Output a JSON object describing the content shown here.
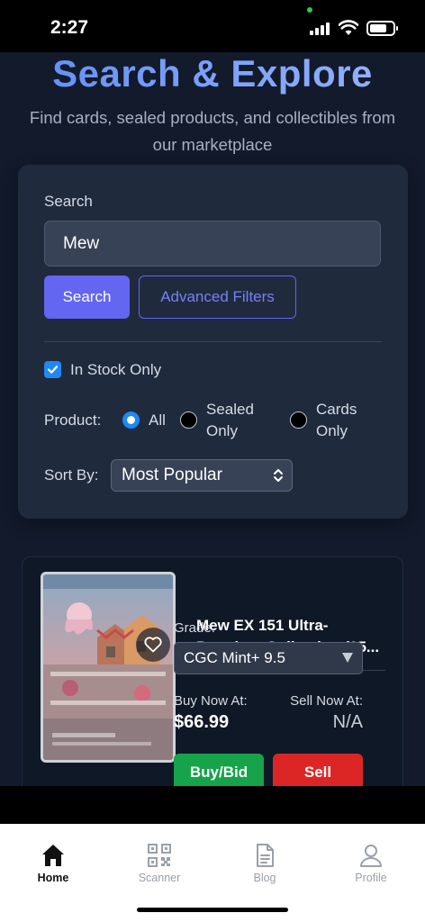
{
  "status_bar": {
    "time": "2:27"
  },
  "header": {
    "title": "Search & Explore",
    "subtitle": "Find cards, sealed products, and collectibles from our marketplace"
  },
  "filters": {
    "search_label": "Search",
    "search_value": "Mew",
    "search_button": "Search",
    "advanced_button": "Advanced Filters",
    "in_stock_label": "In Stock Only",
    "in_stock_checked": true,
    "product_label": "Product:",
    "product_options": [
      {
        "label": "All",
        "selected": true
      },
      {
        "label": "Sealed Only",
        "selected": false
      },
      {
        "label": "Cards Only",
        "selected": false
      }
    ],
    "sort_label": "Sort By:",
    "sort_value": "Most Popular"
  },
  "product": {
    "title": "Mew EX 151 Ultra-Premium Collection (05...",
    "grade_label": "Grade:",
    "grade_value": "CGC Mint+ 9.5",
    "buy_now_label": "Buy Now At:",
    "buy_now_price": "$66.99",
    "sell_now_label": "Sell Now At:",
    "sell_now_price": "N/A",
    "buy_button": "Buy/Bid",
    "sell_button": "Sell"
  },
  "tabs": [
    {
      "label": "Home",
      "icon": "home-icon",
      "active": true
    },
    {
      "label": "Scanner",
      "icon": "qr-code-icon",
      "active": false
    },
    {
      "label": "Blog",
      "icon": "document-icon",
      "active": false
    },
    {
      "label": "Profile",
      "icon": "user-icon",
      "active": false
    }
  ],
  "colors": {
    "background": "#121a2b",
    "card": "#1f2a3d",
    "accent": "#6366f1",
    "buy": "#16a34a",
    "sell": "#dc2626"
  }
}
